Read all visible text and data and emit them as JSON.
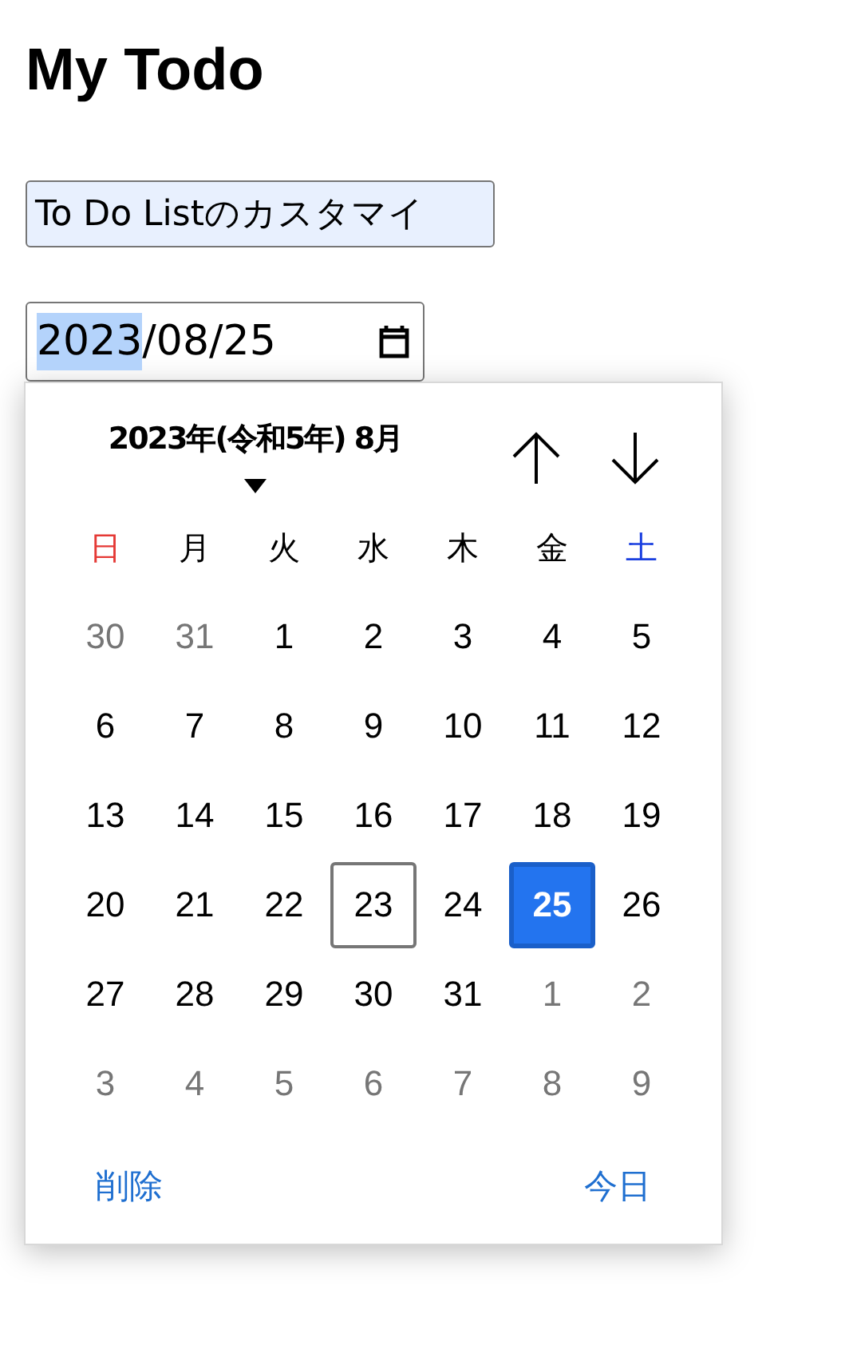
{
  "title": "My Todo",
  "customize_button": {
    "label": "To Do Listのカスタマイ"
  },
  "date_field": {
    "segments": [
      {
        "text": "2023",
        "selected": true
      },
      {
        "text": "/08",
        "selected": false
      },
      {
        "text": "/25",
        "selected": false
      }
    ]
  },
  "calendar": {
    "month_label": "2023年(令和5年) 8月",
    "weekdays": [
      {
        "label": "日",
        "color": "#e53935"
      },
      {
        "label": "月",
        "color": "#000000"
      },
      {
        "label": "火",
        "color": "#000000"
      },
      {
        "label": "水",
        "color": "#000000"
      },
      {
        "label": "木",
        "color": "#000000"
      },
      {
        "label": "金",
        "color": "#000000"
      },
      {
        "label": "土",
        "color": "#1a3fe0"
      }
    ],
    "days": [
      {
        "text": "30",
        "outside": true,
        "today": false,
        "selected": false
      },
      {
        "text": "31",
        "outside": true,
        "today": false,
        "selected": false
      },
      {
        "text": "1",
        "outside": false,
        "today": false,
        "selected": false
      },
      {
        "text": "2",
        "outside": false,
        "today": false,
        "selected": false
      },
      {
        "text": "3",
        "outside": false,
        "today": false,
        "selected": false
      },
      {
        "text": "4",
        "outside": false,
        "today": false,
        "selected": false
      },
      {
        "text": "5",
        "outside": false,
        "today": false,
        "selected": false
      },
      {
        "text": "6",
        "outside": false,
        "today": false,
        "selected": false
      },
      {
        "text": "7",
        "outside": false,
        "today": false,
        "selected": false
      },
      {
        "text": "8",
        "outside": false,
        "today": false,
        "selected": false
      },
      {
        "text": "9",
        "outside": false,
        "today": false,
        "selected": false
      },
      {
        "text": "10",
        "outside": false,
        "today": false,
        "selected": false
      },
      {
        "text": "11",
        "outside": false,
        "today": false,
        "selected": false
      },
      {
        "text": "12",
        "outside": false,
        "today": false,
        "selected": false
      },
      {
        "text": "13",
        "outside": false,
        "today": false,
        "selected": false
      },
      {
        "text": "14",
        "outside": false,
        "today": false,
        "selected": false
      },
      {
        "text": "15",
        "outside": false,
        "today": false,
        "selected": false
      },
      {
        "text": "16",
        "outside": false,
        "today": false,
        "selected": false
      },
      {
        "text": "17",
        "outside": false,
        "today": false,
        "selected": false
      },
      {
        "text": "18",
        "outside": false,
        "today": false,
        "selected": false
      },
      {
        "text": "19",
        "outside": false,
        "today": false,
        "selected": false
      },
      {
        "text": "20",
        "outside": false,
        "today": false,
        "selected": false
      },
      {
        "text": "21",
        "outside": false,
        "today": false,
        "selected": false
      },
      {
        "text": "22",
        "outside": false,
        "today": false,
        "selected": false
      },
      {
        "text": "23",
        "outside": false,
        "today": true,
        "selected": false
      },
      {
        "text": "24",
        "outside": false,
        "today": false,
        "selected": false
      },
      {
        "text": "25",
        "outside": false,
        "today": false,
        "selected": true
      },
      {
        "text": "26",
        "outside": false,
        "today": false,
        "selected": false
      },
      {
        "text": "27",
        "outside": false,
        "today": false,
        "selected": false
      },
      {
        "text": "28",
        "outside": false,
        "today": false,
        "selected": false
      },
      {
        "text": "29",
        "outside": false,
        "today": false,
        "selected": false
      },
      {
        "text": "30",
        "outside": false,
        "today": false,
        "selected": false
      },
      {
        "text": "31",
        "outside": false,
        "today": false,
        "selected": false
      },
      {
        "text": "1",
        "outside": true,
        "today": false,
        "selected": false
      },
      {
        "text": "2",
        "outside": true,
        "today": false,
        "selected": false
      },
      {
        "text": "3",
        "outside": true,
        "today": false,
        "selected": false
      },
      {
        "text": "4",
        "outside": true,
        "today": false,
        "selected": false
      },
      {
        "text": "5",
        "outside": true,
        "today": false,
        "selected": false
      },
      {
        "text": "6",
        "outside": true,
        "today": false,
        "selected": false
      },
      {
        "text": "7",
        "outside": true,
        "today": false,
        "selected": false
      },
      {
        "text": "8",
        "outside": true,
        "today": false,
        "selected": false
      },
      {
        "text": "9",
        "outside": true,
        "today": false,
        "selected": false
      }
    ],
    "clear_button": "削除",
    "today_button": "今日"
  }
}
